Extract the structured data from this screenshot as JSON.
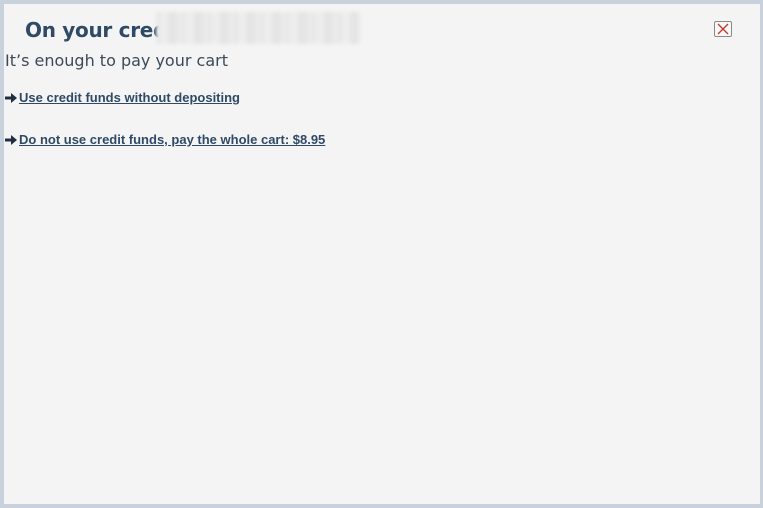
{
  "dialog": {
    "title": "On your credit",
    "subtitle": "It’s enough to pay your cart",
    "close_icon": "close-icon"
  },
  "options": [
    {
      "label": "Use credit funds without depositing",
      "icon": "arrow-right-icon"
    },
    {
      "label": "Do not use credit funds, pay the whole cart: $8.95",
      "icon": "arrow-right-icon"
    }
  ],
  "colors": {
    "title": "#2f4a66",
    "background": "#f4f4f4",
    "close_x": "#c0392b"
  }
}
